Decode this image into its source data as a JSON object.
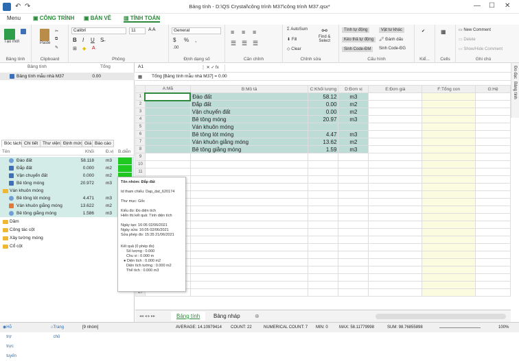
{
  "title_bar": {
    "title": "Bảng tính - D:\\QS Crystal\\công trình M37\\công trình M37.qsx*"
  },
  "tabs": {
    "menu": "Menu",
    "cong_trinh": "CÔNG TRÌNH",
    "ban_ve": "BẢN VẼ",
    "tinh_toan": "TÍNH TOÁN"
  },
  "ribbon": {
    "bang_tinh": {
      "label": "Bảng tính",
      "new": "Tạo mới"
    },
    "clipboard": {
      "label": "Clipboard",
      "paste": "Paste"
    },
    "font": {
      "label": "Phông",
      "font_name": "Calibri",
      "size": "11"
    },
    "number": {
      "label": "Định dạng số",
      "format": "General"
    },
    "align": {
      "label": "Căn chỉnh"
    },
    "edit": {
      "label": "Chỉnh sửa",
      "autosum": "AutoSum",
      "fill": "Fill",
      "clear": "Clear",
      "find": "Find &",
      "select": "Select"
    },
    "config": {
      "label": "Cấu hình",
      "auto_calc": "Tính tự động",
      "drag": "Kéo thả tự động",
      "gen_code_dm": "Sinh Code-ĐM",
      "copy_other": "Vật tư khác",
      "mark": "Đánh dấu",
      "gen_code_dg": "Sinh Code-ĐG"
    },
    "more": {
      "label": "Kiể...",
      "cells": "Cells"
    },
    "notes": {
      "label": "Ghi chú",
      "new": "New Comment",
      "delete": "Delete",
      "show_hide": "Show/Hide Comment"
    }
  },
  "left": {
    "head_name": "Bảng tính",
    "head_total": "Tổng",
    "sheet_item": "Bảng tính mẫu nhà M37",
    "sheet_total": "0.00",
    "tabs": [
      "Bóc tách",
      "Chi tiết",
      "Thư viện",
      "Định mức",
      "Giá",
      "Báo cáo"
    ],
    "cols": {
      "name": "Tên",
      "qty": "Khối lượng",
      "unit": "Đ.vị",
      "note": "B.diễn"
    },
    "items": [
      {
        "name": "Đào đất",
        "qty": "58.118",
        "unit": "m3"
      },
      {
        "name": "Đắp đất",
        "qty": "0.000",
        "unit": "m2"
      },
      {
        "name": "Vận chuyển đất",
        "qty": "0.000",
        "unit": "m2"
      },
      {
        "name": "Bê tông móng",
        "qty": "20.972",
        "unit": "m3"
      },
      {
        "name": "Ván khuôn móng",
        "qty": "",
        "unit": ""
      },
      {
        "name": "Bê tông lót móng",
        "qty": "4.471",
        "unit": "m3"
      },
      {
        "name": "Ván khuôn giằng móng",
        "qty": "13.622",
        "unit": "m2"
      },
      {
        "name": "Bê tông giằng móng",
        "qty": "1.586",
        "unit": "m3"
      },
      {
        "name": "Dầm",
        "qty": "",
        "unit": ""
      },
      {
        "name": "Công tác cột",
        "qty": "",
        "unit": ""
      },
      {
        "name": "Xây tường móng",
        "qty": "",
        "unit": ""
      },
      {
        "name": "Cổ cột",
        "qty": "",
        "unit": ""
      }
    ]
  },
  "tooltip": {
    "l1": "Tên nhóm: Đắp đất",
    "l2": "Id tham chiếu: Dap_dat_620174",
    "l3": "Thư mục: Gốc",
    "l4": "Kiểu đo: Đo diện tích",
    "l5": "Hiển thị kết quả: Tính diện tích",
    "l6": "Ngày tạo: 16:05 02/06/2021",
    "l7": "Ngày sửa: 16:05 02/06/2021",
    "l8": "Sửa phép đo: 15:35 21/06/2021",
    "l9": "Kết quả (0 phép đo)",
    "l10": "Số lượng : 0.000",
    "l11": "Chu vi : 0.000 m",
    "l12": "Diện tích : 0.000 m2",
    "l13": "Diện tích tường : 0.000 m2",
    "l14": "Thể tích : 0.000 m3"
  },
  "formula": {
    "cell": "A1",
    "total_label": "Tổng [Bảng tính mẫu nhà M37] = 0.00"
  },
  "sheet": {
    "headers": [
      "A:Mã",
      "B:Mô tả",
      "C:Khối lượng",
      "D:Đơn vị",
      "E:Đơn giá",
      "F:Tổng con",
      "G:Hệ"
    ],
    "rows": [
      {
        "b": "Đào đất",
        "c": "58.12",
        "d": "m3"
      },
      {
        "b": "Đắp đất",
        "c": "0.00",
        "d": "m2"
      },
      {
        "b": "Vận chuyển đất",
        "c": "0.00",
        "d": "m2"
      },
      {
        "b": "Bê tông móng",
        "c": "20.97",
        "d": "m3"
      },
      {
        "b": "Ván khuôn móng",
        "c": "",
        "d": ""
      },
      {
        "b": "Bê tông lót móng",
        "c": "4.47",
        "d": "m3"
      },
      {
        "b": "Ván khuôn giằng móng",
        "c": "13.62",
        "d": "m2"
      },
      {
        "b": "Bê tông giằng móng",
        "c": "1.59",
        "d": "m3"
      }
    ]
  },
  "sheet_tabs": [
    "Bảng tính",
    "Bảng nháp"
  ],
  "vtabs": [
    "Đo đạc",
    "Bảng tính"
  ],
  "status": {
    "support": "Hỗ trợ trực tuyến",
    "home": "Trang chủ",
    "items": "[9 nhóm]",
    "average": "AVERAGE: 14.10979414",
    "count": "COUNT: 22",
    "numcount": "NUMERICAL COUNT: 7",
    "min": "MIN: 0",
    "max": "MAX: 58.11779998",
    "sum": "SUM: 98.76855898",
    "zoom": "100%"
  }
}
